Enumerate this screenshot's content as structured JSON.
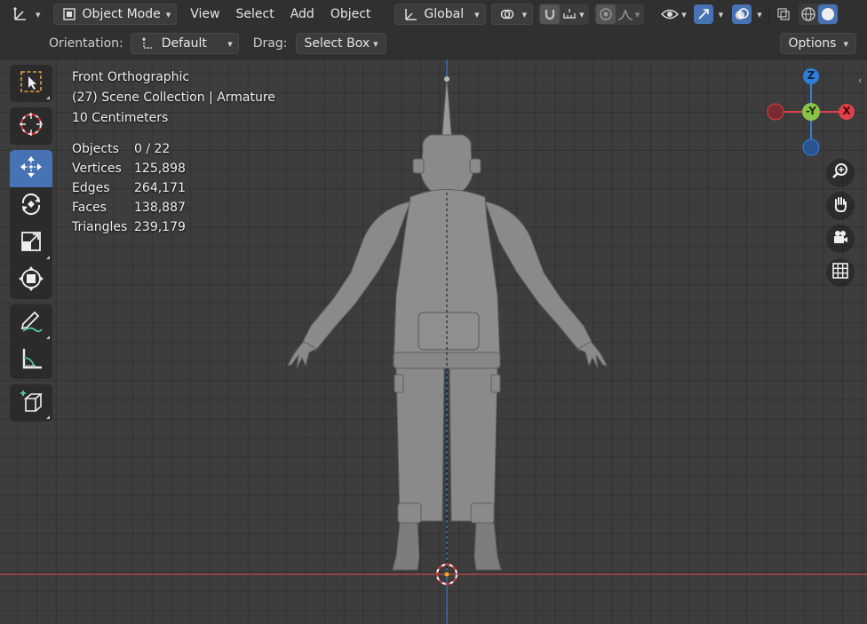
{
  "header": {
    "mode_label": "Object Mode",
    "menus": [
      "View",
      "Select",
      "Add",
      "Object"
    ],
    "transform_orientation": "Global"
  },
  "tool_settings": {
    "orientation_label": "Orientation:",
    "orientation_value": "Default",
    "drag_label": "Drag:",
    "drag_value": "Select Box",
    "options_label": "Options"
  },
  "overlay": {
    "view_name": "Front Orthographic",
    "collection": "(27) Scene Collection | Armature",
    "scale": "10 Centimeters",
    "stats": [
      {
        "label": "Objects",
        "value": "0 / 22"
      },
      {
        "label": "Vertices",
        "value": "125,898"
      },
      {
        "label": "Edges",
        "value": "264,171"
      },
      {
        "label": "Faces",
        "value": "138,887"
      },
      {
        "label": "Triangles",
        "value": "239,179"
      }
    ]
  },
  "gizmo": {
    "z_label": "Z",
    "y_label": "-Y",
    "x_label": "X",
    "colors": {
      "x": "#e0404a",
      "y": "#8bc34a",
      "z": "#2f7fd8"
    }
  },
  "toolbar_tools": [
    "select-box",
    "cursor",
    "move",
    "rotate",
    "scale",
    "transform",
    "annotate",
    "measure",
    "add-cube"
  ],
  "colors": {
    "accent": "#4772b3",
    "header": "#303030",
    "viewport": "#3d3d3d"
  }
}
